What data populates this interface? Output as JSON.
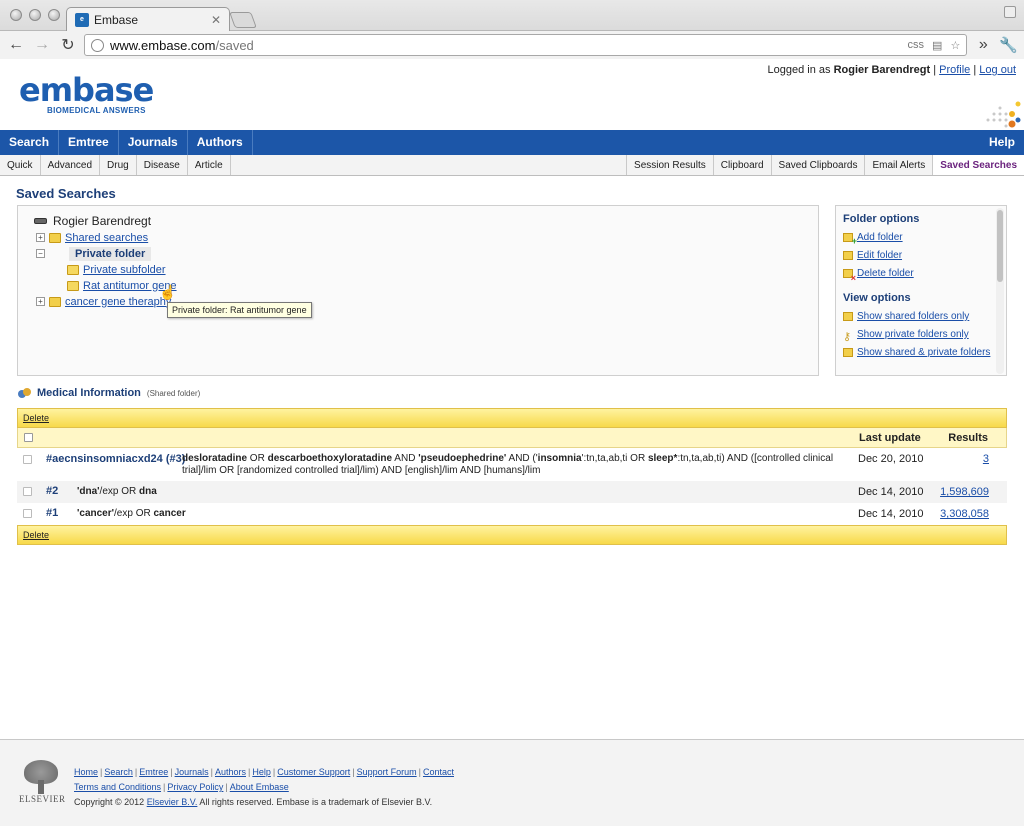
{
  "browser": {
    "tab_title": "Embase",
    "tab_favicon": "elsevier",
    "url_host": "www.embase.com",
    "url_path": "/saved",
    "omnibox_extra": "css"
  },
  "header": {
    "logged_in_prefix": "Logged in as ",
    "user_name": "Rogier Barendregt",
    "profile": "Profile",
    "logout": "Log out",
    "logo_word": "embase",
    "logo_tagline": "BIOMEDICAL ANSWERS",
    "separator": "|"
  },
  "main_nav": [
    {
      "label": "Search"
    },
    {
      "label": "Emtree"
    },
    {
      "label": "Journals"
    },
    {
      "label": "Authors"
    }
  ],
  "help_label": "Help",
  "sub_nav_left": [
    "Quick",
    "Advanced",
    "Drug",
    "Disease",
    "Article"
  ],
  "sub_nav_right": [
    "Session Results",
    "Clipboard",
    "Saved Clipboards",
    "Email Alerts",
    "Saved Searches"
  ],
  "page_title": "Saved Searches",
  "tree": {
    "root": "Rogier Barendregt",
    "items": [
      {
        "label": "Shared searches",
        "toggle": "+"
      },
      {
        "label": "Private folder",
        "toggle": "−"
      },
      {
        "label": "Private subfolder"
      },
      {
        "label": "Rat antitumor gene"
      },
      {
        "label": "cancer gene theraphy",
        "toggle": "+"
      }
    ],
    "tooltip": "Private folder: Rat antitumor gene"
  },
  "options": {
    "folder_heading": "Folder options",
    "folder_items": [
      "Add folder",
      "Edit folder",
      "Delete folder"
    ],
    "view_heading": "View options",
    "view_items": [
      "Show shared folders only",
      "Show private folders only",
      "Show shared & private folders"
    ]
  },
  "section": {
    "title": "Medical Information",
    "subtitle": "(Shared folder)"
  },
  "delete_label": "Delete",
  "table": {
    "col_last_update": "Last update",
    "col_results": "Results",
    "rows": [
      {
        "id": "#aecnsinsomniacxd24 (#3)",
        "query_line1_a": "desloratadine",
        "query_line1_b": " OR ",
        "query_line1_c": "descarboethoxyloratadine",
        "query_line1_d": " AND ",
        "query_line1_e": "'pseudoephedrine'",
        "query_line1_f": " AND ('",
        "query_line1_g": "insomnia",
        "query_line1_h": "':tn,ta,ab,ti OR ",
        "query_line1_i": "sleep*",
        "query_line1_j": ":tn,ta,ab,ti) AND ([controlled clinical",
        "query_line2": "trial]/lim OR [randomized controlled trial]/lim) AND [english]/lim AND [humans]/lim",
        "date": "Dec 20, 2010",
        "results": "3"
      },
      {
        "id": "#2",
        "query_a": "'dna'",
        "query_b": "/exp OR ",
        "query_c": "dna",
        "date": "Dec 14, 2010",
        "results": "1,598,609"
      },
      {
        "id": "#1",
        "query_a": "'cancer'",
        "query_b": "/exp OR ",
        "query_c": "cancer",
        "date": "Dec 14, 2010",
        "results": "3,308,058"
      }
    ]
  },
  "footer": {
    "links_line1": [
      "Home",
      "Search",
      "Emtree",
      "Journals",
      "Authors",
      "Help",
      "Customer Support",
      "Support Forum",
      "Contact"
    ],
    "links_line2": [
      "Terms and Conditions",
      "Privacy Policy",
      "About Embase"
    ],
    "copyright_pre": "Copyright © 2012 ",
    "copyright_link": "Elsevier B.V.",
    "copyright_post": " All rights reserved. Embase is a trademark of Elsevier B.V.",
    "elsevier_word": "ELSEVIER"
  },
  "colors": {
    "nav_blue": "#1c56a8",
    "title_blue": "#1d3f78",
    "active_purple": "#6b237e",
    "yellow_bar": "#f7d94a"
  }
}
